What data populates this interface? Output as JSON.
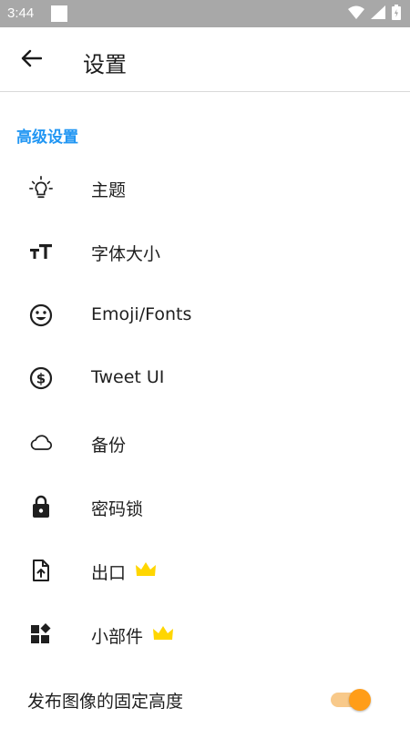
{
  "status_bar": {
    "time": "3:44",
    "icons": [
      "wifi-icon",
      "signal-icon",
      "battery-icon"
    ]
  },
  "app_bar": {
    "back_icon": "arrow-back-icon",
    "title": "设置"
  },
  "section": {
    "title": "高级设置",
    "color": "#2196f3"
  },
  "menu": {
    "items": [
      {
        "label": "主题",
        "icon": "lightbulb-icon"
      },
      {
        "label": "字体大小",
        "icon": "text-size-icon"
      },
      {
        "label": "Emoji/Fonts",
        "icon": "emoji-icon"
      },
      {
        "label": "Tweet UI",
        "icon": "sync-icon"
      },
      {
        "label": "备份",
        "icon": "cloud-icon"
      },
      {
        "label": "密码锁",
        "icon": "lock-icon"
      },
      {
        "label": "出口",
        "icon": "file-upload-icon",
        "premium": true
      },
      {
        "label": "小部件",
        "icon": "widgets-icon",
        "premium": true
      }
    ]
  },
  "toggle": {
    "label": "发布图像的固定高度",
    "checked": true,
    "accent": "#ff9d18"
  },
  "premium_crown_color": "#ffd600"
}
